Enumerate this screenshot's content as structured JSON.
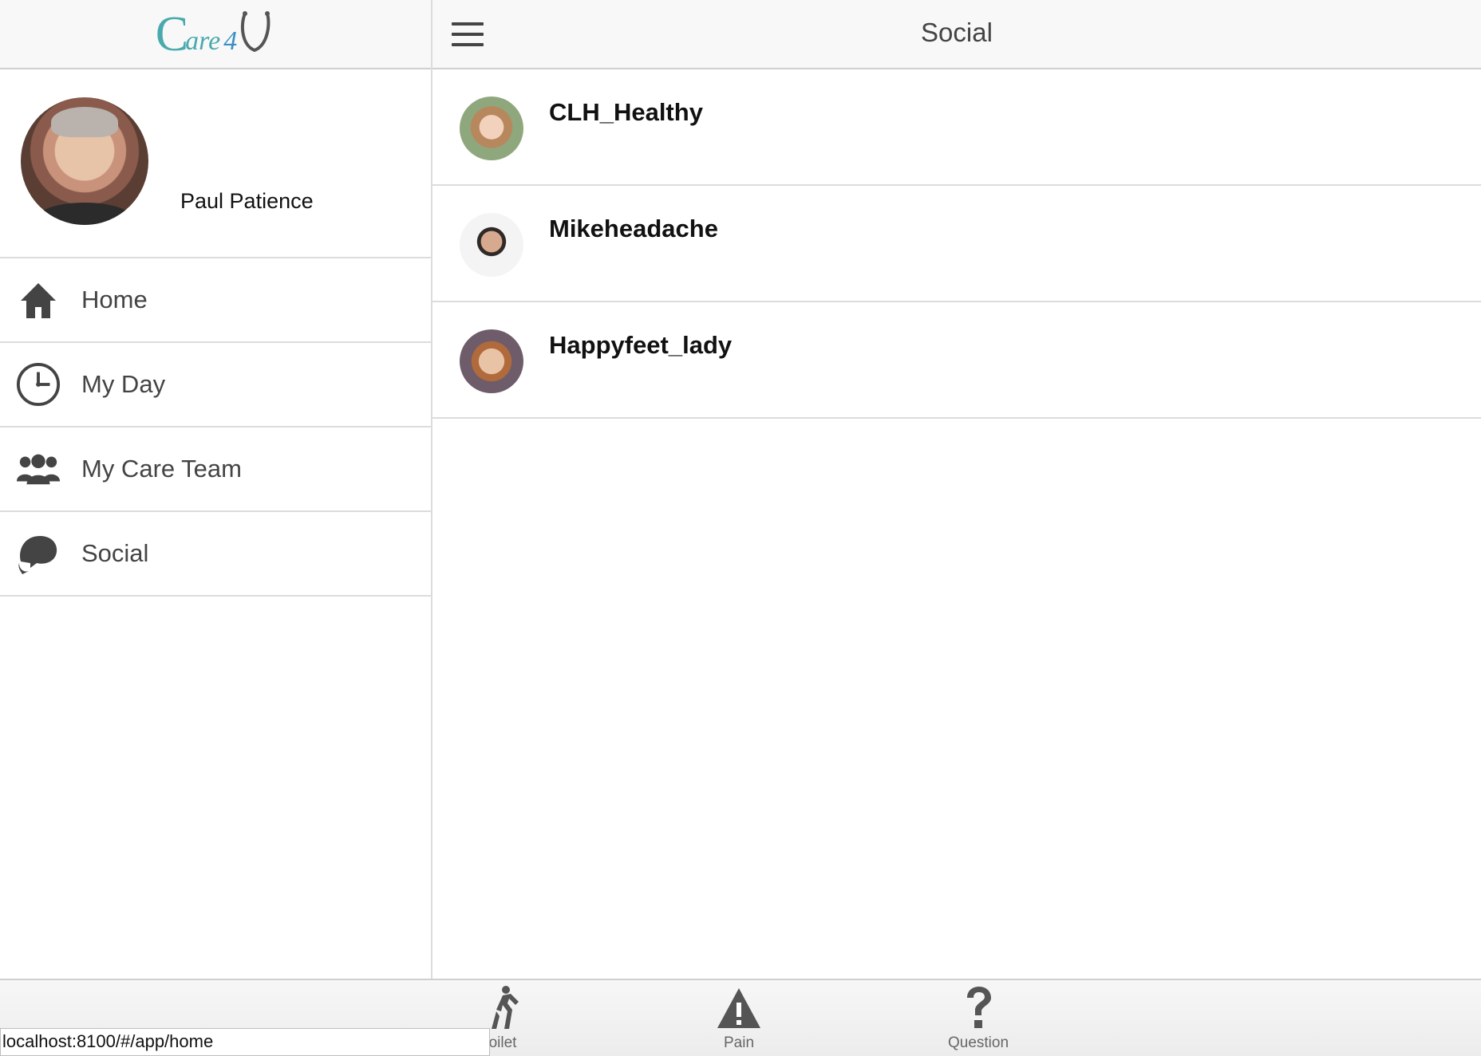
{
  "app": {
    "logo_text_c": "C",
    "logo_text_are": "are",
    "logo_text_4": "4"
  },
  "sidebar": {
    "user_name": "Paul Patience",
    "items": [
      {
        "label": "Home",
        "icon": "home-icon"
      },
      {
        "label": "My Day",
        "icon": "clock-icon"
      },
      {
        "label": "My Care Team",
        "icon": "people-icon"
      },
      {
        "label": "Social",
        "icon": "chat-bubble-icon"
      }
    ]
  },
  "header": {
    "title": "Social",
    "menu_icon": "hamburger-icon"
  },
  "social": {
    "users": [
      {
        "name": "CLH_Healthy"
      },
      {
        "name": "Mikeheadache"
      },
      {
        "name": "Happyfeet_lady"
      }
    ]
  },
  "tabbar": {
    "tabs": [
      {
        "label": "oilet",
        "icon": "walking-person-icon"
      },
      {
        "label": "Pain",
        "icon": "warning-icon"
      },
      {
        "label": "Question",
        "icon": "question-mark-icon"
      }
    ]
  },
  "statusbar": {
    "url": "localhost:8100/#/app/home"
  },
  "colors": {
    "brand_teal": "#4aa9ad",
    "icon_dark": "#444444",
    "divider": "#dcdcdc"
  }
}
